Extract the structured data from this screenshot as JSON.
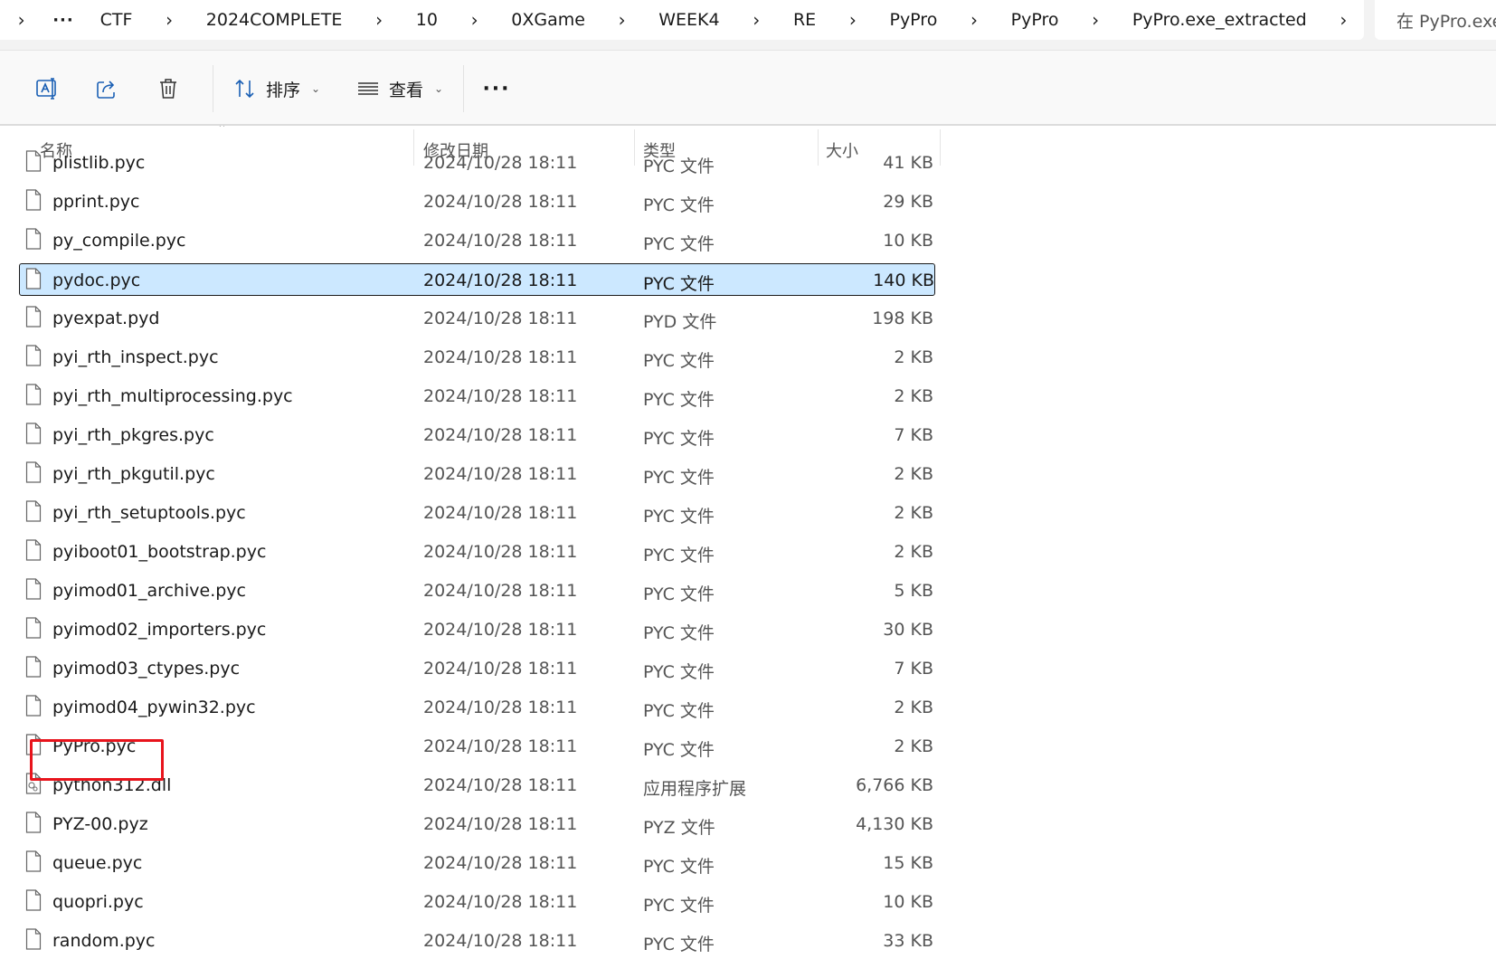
{
  "address_bar": {
    "crumbs": [
      "CTF",
      "2024COMPLETE",
      "10",
      "0XGame",
      "WEEK4",
      "RE",
      "PyPro",
      "PyPro",
      "PyPro.exe_extracted"
    ],
    "more": "···",
    "search_placeholder": "在 PyPro.exe_extracted 中搜索"
  },
  "toolbar": {
    "sort_label": "排序",
    "view_label": "查看",
    "more_label": "···"
  },
  "columns": {
    "name": "名称",
    "date": "修改日期",
    "type": "类型",
    "size": "大小"
  },
  "files": [
    {
      "name": "plistlib.pyc",
      "date": "2024/10/28 18:11",
      "type": "PYC 文件",
      "size": "41 KB",
      "icon": "file-icon"
    },
    {
      "name": "pprint.pyc",
      "date": "2024/10/28 18:11",
      "type": "PYC 文件",
      "size": "29 KB",
      "icon": "file-icon"
    },
    {
      "name": "py_compile.pyc",
      "date": "2024/10/28 18:11",
      "type": "PYC 文件",
      "size": "10 KB",
      "icon": "file-icon"
    },
    {
      "name": "pydoc.pyc",
      "date": "2024/10/28 18:11",
      "type": "PYC 文件",
      "size": "140 KB",
      "icon": "file-icon",
      "selected": true
    },
    {
      "name": "pyexpat.pyd",
      "date": "2024/10/28 18:11",
      "type": "PYD 文件",
      "size": "198 KB",
      "icon": "file-icon"
    },
    {
      "name": "pyi_rth_inspect.pyc",
      "date": "2024/10/28 18:11",
      "type": "PYC 文件",
      "size": "2 KB",
      "icon": "file-icon"
    },
    {
      "name": "pyi_rth_multiprocessing.pyc",
      "date": "2024/10/28 18:11",
      "type": "PYC 文件",
      "size": "2 KB",
      "icon": "file-icon"
    },
    {
      "name": "pyi_rth_pkgres.pyc",
      "date": "2024/10/28 18:11",
      "type": "PYC 文件",
      "size": "7 KB",
      "icon": "file-icon"
    },
    {
      "name": "pyi_rth_pkgutil.pyc",
      "date": "2024/10/28 18:11",
      "type": "PYC 文件",
      "size": "2 KB",
      "icon": "file-icon"
    },
    {
      "name": "pyi_rth_setuptools.pyc",
      "date": "2024/10/28 18:11",
      "type": "PYC 文件",
      "size": "2 KB",
      "icon": "file-icon"
    },
    {
      "name": "pyiboot01_bootstrap.pyc",
      "date": "2024/10/28 18:11",
      "type": "PYC 文件",
      "size": "2 KB",
      "icon": "file-icon"
    },
    {
      "name": "pyimod01_archive.pyc",
      "date": "2024/10/28 18:11",
      "type": "PYC 文件",
      "size": "5 KB",
      "icon": "file-icon"
    },
    {
      "name": "pyimod02_importers.pyc",
      "date": "2024/10/28 18:11",
      "type": "PYC 文件",
      "size": "30 KB",
      "icon": "file-icon"
    },
    {
      "name": "pyimod03_ctypes.pyc",
      "date": "2024/10/28 18:11",
      "type": "PYC 文件",
      "size": "7 KB",
      "icon": "file-icon"
    },
    {
      "name": "pyimod04_pywin32.pyc",
      "date": "2024/10/28 18:11",
      "type": "PYC 文件",
      "size": "2 KB",
      "icon": "file-icon"
    },
    {
      "name": "PyPro.pyc",
      "date": "2024/10/28 18:11",
      "type": "PYC 文件",
      "size": "2 KB",
      "icon": "file-icon",
      "highlighted": true
    },
    {
      "name": "python312.dll",
      "date": "2024/10/28 18:11",
      "type": "应用程序扩展",
      "size": "6,766 KB",
      "icon": "dll-file-icon"
    },
    {
      "name": "PYZ-00.pyz",
      "date": "2024/10/28 18:11",
      "type": "PYZ 文件",
      "size": "4,130 KB",
      "icon": "file-icon"
    },
    {
      "name": "queue.pyc",
      "date": "2024/10/28 18:11",
      "type": "PYC 文件",
      "size": "15 KB",
      "icon": "file-icon"
    },
    {
      "name": "quopri.pyc",
      "date": "2024/10/28 18:11",
      "type": "PYC 文件",
      "size": "10 KB",
      "icon": "file-icon"
    },
    {
      "name": "random.pyc",
      "date": "2024/10/28 18:11",
      "type": "PYC 文件",
      "size": "33 KB",
      "icon": "file-icon"
    }
  ],
  "colors": {
    "selection": "#cce8ff",
    "highlight_box": "#e8141c",
    "accent": "#0067c0"
  }
}
